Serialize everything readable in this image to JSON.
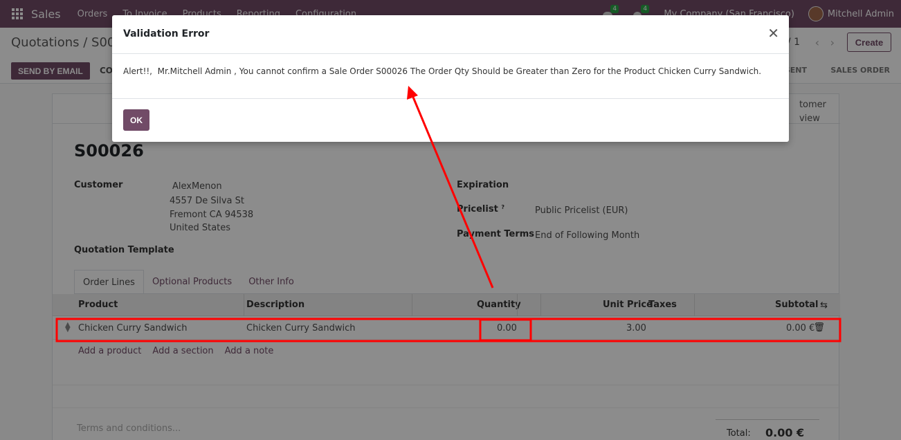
{
  "navbar": {
    "app_name": "Sales",
    "menu": [
      "Orders",
      "To Invoice",
      "Products",
      "Reporting",
      "Configuration"
    ],
    "messages_count": "4",
    "activities_count": "4",
    "company": "My Company (San Francisco)",
    "user": "Mitchell Admin"
  },
  "control_panel": {
    "breadcrumb": "Quotations / S000",
    "pager": "/ 1",
    "create_label": "Create",
    "send_email_label": "SEND BY EMAIL",
    "confirm_partial": "CO",
    "status_sent": "SENT",
    "status_sales_order": "SALES ORDER"
  },
  "form": {
    "customer_preview": [
      "tomer",
      "view"
    ],
    "order_name": "S00026",
    "customer_label": "Customer",
    "customer_name": "AlexMenon",
    "address": [
      "4557 De Silva St",
      "Fremont CA 94538",
      "United States"
    ],
    "template_label": "Quotation Template",
    "expiration_label": "Expiration",
    "pricelist_label": "Pricelist",
    "pricelist_help": "?",
    "pricelist_value": "Public Pricelist (EUR)",
    "payment_terms_label": "Payment Terms",
    "payment_terms_value": "End of Following Month"
  },
  "tabs": [
    "Order Lines",
    "Optional Products",
    "Other Info"
  ],
  "table": {
    "headers": {
      "product": "Product",
      "description": "Description",
      "quantity": "Quantity",
      "unit_price": "Unit Price",
      "taxes": "Taxes",
      "subtotal": "Subtotal"
    },
    "rows": [
      {
        "product": "Chicken Curry Sandwich",
        "description": "Chicken Curry Sandwich",
        "quantity": "0.00",
        "unit_price": "3.00",
        "taxes": "",
        "subtotal": "0.00 €"
      }
    ],
    "add_links": [
      "Add a product",
      "Add a section",
      "Add a note"
    ]
  },
  "footer": {
    "terms_placeholder": "Terms and conditions...",
    "total_label": "Total:",
    "total_value": "0.00 €"
  },
  "modal": {
    "title": "Validation Error",
    "message": "Alert!!,  Mr.Mitchell Admin , You cannot confirm a Sale Order S00026 The Order Qty Should be Greater than Zero for the Product Chicken Curry Sandwich.",
    "ok_label": "OK",
    "close_glyph": "✕"
  },
  "colors": {
    "brand": "#714b67",
    "annotation": "#ff0000"
  }
}
